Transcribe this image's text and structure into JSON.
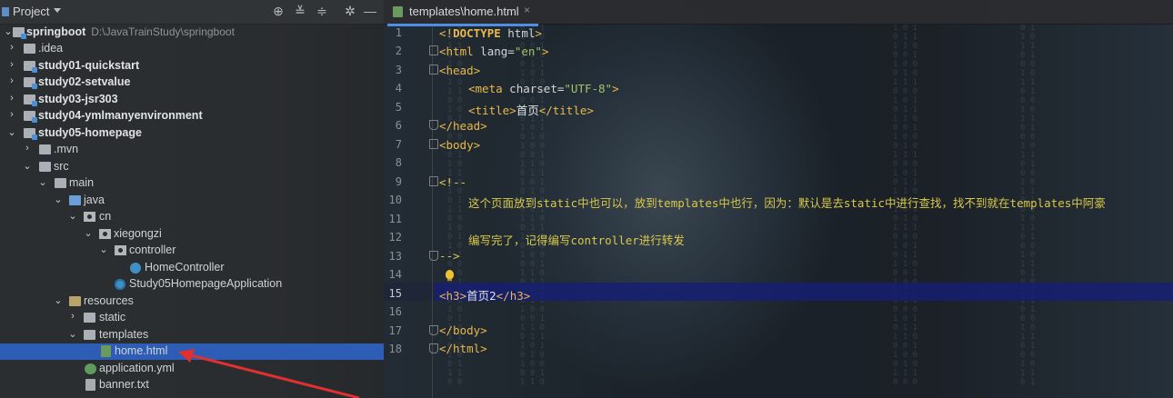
{
  "project_panel": {
    "title": "Project",
    "toolbar_icons": [
      "locate-icon",
      "expand-all-icon",
      "collapse-all-icon",
      "gear-icon",
      "hide-icon"
    ],
    "tree": [
      {
        "label": "springboot",
        "path": "D:\\JavaTrainStudy\\springboot",
        "bold": true
      },
      {
        "label": ".idea"
      },
      {
        "label": "study01-quickstart",
        "bold": true
      },
      {
        "label": "study02-setvalue",
        "bold": true
      },
      {
        "label": "study03-jsr303",
        "bold": true
      },
      {
        "label": "study04-ymlmanyenvironment",
        "bold": true
      },
      {
        "label": "study05-homepage",
        "bold": true
      },
      {
        "label": ".mvn"
      },
      {
        "label": "src"
      },
      {
        "label": "main"
      },
      {
        "label": "java"
      },
      {
        "label": "cn"
      },
      {
        "label": "xiegongzi"
      },
      {
        "label": "controller"
      },
      {
        "label": "HomeController"
      },
      {
        "label": "Study05HomepageApplication"
      },
      {
        "label": "resources"
      },
      {
        "label": "static"
      },
      {
        "label": "templates"
      },
      {
        "label": "home.html",
        "selected": true
      },
      {
        "label": "application.yml"
      },
      {
        "label": "banner.txt"
      }
    ]
  },
  "editor": {
    "tab": {
      "label": "templates\\home.html",
      "close": "×"
    },
    "current_line": 15,
    "line_numbers": [
      "1",
      "2",
      "3",
      "4",
      "5",
      "6",
      "7",
      "8",
      "9",
      "10",
      "11",
      "12",
      "13",
      "14",
      "15",
      "16",
      "17",
      "18"
    ],
    "code": {
      "l1": {
        "open": "<!",
        "kw": "DOCTYPE",
        "rest": " html",
        "close": ">"
      },
      "l2": {
        "open": "<html",
        "attr": " lang",
        "eq": "=",
        "val": "\"en\"",
        "close": ">"
      },
      "l3": "<head>",
      "l4": {
        "open": "<meta",
        "attr": " charset",
        "eq": "=",
        "val": "\"UTF-8\"",
        "close": ">"
      },
      "l5": {
        "open": "<title>",
        "text": "首页",
        "close": "</title>"
      },
      "l6": "</head>",
      "l7": "<body>",
      "l9": "<!--",
      "l10": "这个页面放到static中也可以，放到templates中也行，因为：默认是去static中进行查找，找不到就在templates中阿豪",
      "l12": "编写完了，记得编写controller进行转发",
      "l13": "-->",
      "l15": {
        "open": "<h3>",
        "text": "首页2",
        "close": "</h3>"
      },
      "l17": "</body>",
      "l18": "</html>"
    }
  },
  "colors": {
    "selection": "#2e5db5",
    "current_line": "#14207a",
    "tag": "#e8b84b",
    "string": "#9fc46a",
    "comment": "#d9c94a",
    "annotation_arrow": "#e03030"
  }
}
